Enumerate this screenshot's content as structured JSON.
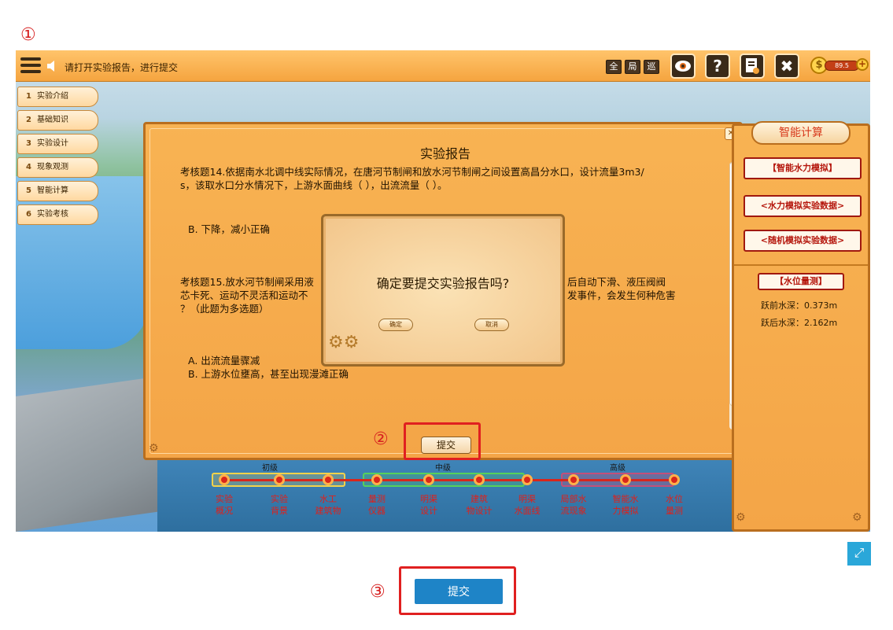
{
  "callouts": {
    "c1": "①",
    "c2": "②",
    "c3": "③"
  },
  "topbar": {
    "hint_text": "请打开实验报告，进行提交",
    "small_buttons": [
      "全",
      "局",
      "巡"
    ],
    "big_buttons": {
      "eye": "👁",
      "help": "?",
      "report": "📋",
      "tools": "✖"
    },
    "coin_value": "89.5",
    "coin_symbol": "$",
    "coin_plus": "+"
  },
  "steps": [
    {
      "num": "1",
      "label": "实验介绍"
    },
    {
      "num": "2",
      "label": "基础知识"
    },
    {
      "num": "3",
      "label": "实验设计"
    },
    {
      "num": "4",
      "label": "现象观测"
    },
    {
      "num": "5",
      "label": "智能计算"
    },
    {
      "num": "6",
      "label": "实验考核"
    }
  ],
  "report": {
    "title": "实验报告",
    "close": "✕",
    "q14_line1": "考核题14.依据南水北调中线实际情况，在唐河节制闸和放水河节制闸之间设置高昌分水口，设计流量3m3/",
    "q14_line2": "s，该取水口分水情况下，上游水面曲线（ ），出流流量（ ）。",
    "q14_answer": "B. 下降，减小正确",
    "q15_line1_left": "考核题15.放水河节制闸采用液",
    "q15_line1_right": "后自动下滑、液压阀阀",
    "q15_line2_left": "芯卡死、运动不灵活和运动不",
    "q15_line2_right": "发事件，会发生何种危害",
    "q15_line3": "？（此题为多选题）",
    "q15_answer_a": "A. 出流流量骤减",
    "q15_answer_b": "B. 上游水位壅高，甚至出现漫滩正确",
    "submit_label": "提交"
  },
  "dialog": {
    "message": "确定要提交实验报告吗?",
    "confirm_label": "确定",
    "cancel_label": "取消"
  },
  "right_panel": {
    "title": "智能计算",
    "btn1": "【智能水力模拟】",
    "btn2": "<水力模拟实验数据>",
    "btn3": "<随机模拟实验数据>",
    "tag": "【水位量测】",
    "before_depth": "跃前水深：0.373m",
    "after_depth": "跃后水深：2.162m"
  },
  "progress": {
    "levels": [
      "初级",
      "中级",
      "高级"
    ],
    "nodes": [
      "实验\n概况",
      "实验\n背景",
      "水工\n建筑物",
      "量测\n仪器",
      "明渠\n设计",
      "建筑\n物设计",
      "明渠\n水面线",
      "局部水\n流现象",
      "智能水\n力模拟",
      "水位\n量测"
    ],
    "level_colors": {
      "beginner": "#f3d24a",
      "middle": "#57d05a",
      "advanced": "#c2507a"
    },
    "accent": "#d8261c"
  },
  "bottom": {
    "submit_label": "提交",
    "expand_icon": "⤢"
  }
}
